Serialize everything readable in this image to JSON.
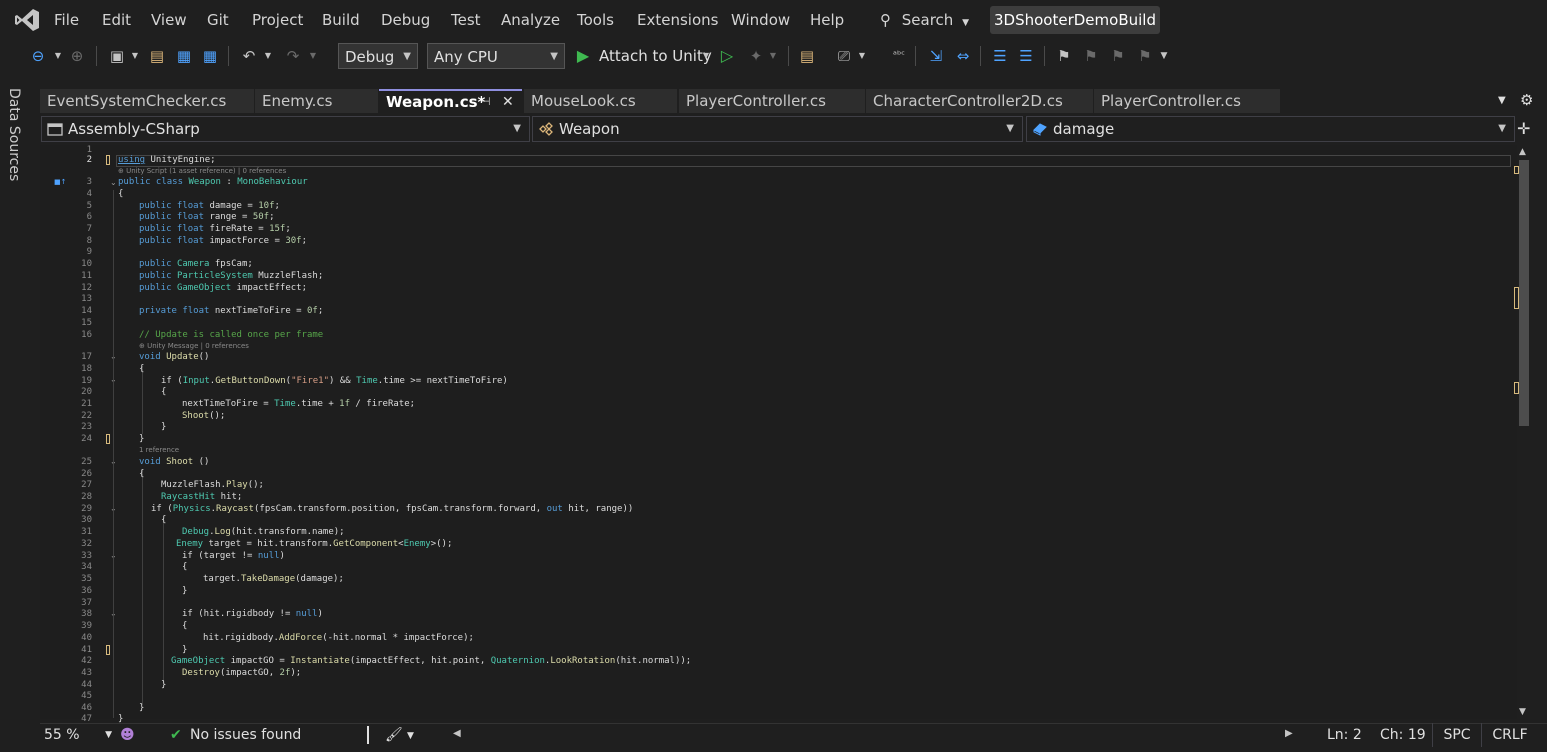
{
  "window": {
    "solution_name": "3DShooterDemoBuild"
  },
  "menu": [
    "File",
    "Edit",
    "View",
    "Git",
    "Project",
    "Build",
    "Debug",
    "Test",
    "Analyze",
    "Tools",
    "Extensions",
    "Window",
    "Help"
  ],
  "search": {
    "label": "Search"
  },
  "toolbar": {
    "configuration": "Debug",
    "platform": "Any CPU",
    "attach_label": "Attach to Unity"
  },
  "side_panel": {
    "label": "Data Sources"
  },
  "tabs": [
    {
      "label": "EventSystemChecker.cs",
      "active": false
    },
    {
      "label": "Enemy.cs",
      "active": false
    },
    {
      "label": "Weapon.cs*",
      "active": true
    },
    {
      "label": "MouseLook.cs",
      "active": false
    },
    {
      "label": "PlayerController.cs",
      "active": false
    },
    {
      "label": "CharacterController2D.cs",
      "active": false
    },
    {
      "label": "PlayerController.cs",
      "active": false
    }
  ],
  "navbar": {
    "project": "Assembly-CSharp",
    "type": "Weapon",
    "member": "damage"
  },
  "editor": {
    "current_line": 2,
    "line_numbers": [
      "1",
      "2",
      "3",
      "4",
      "5",
      "6",
      "7",
      "8",
      "9",
      "10",
      "11",
      "12",
      "13",
      "14",
      "15",
      "16",
      "17",
      "18",
      "19",
      "20",
      "21",
      "22",
      "23",
      "24",
      "25",
      "26",
      "27",
      "28",
      "29",
      "30",
      "31",
      "32",
      "33",
      "34",
      "35",
      "36",
      "37",
      "38",
      "39",
      "40",
      "41",
      "42",
      "43",
      "44",
      "45",
      "46",
      "47"
    ],
    "lens": {
      "class": "Unity Script (1 asset reference) | 0 references",
      "update": "Unity Message | 0 references",
      "shoot": "1 reference"
    },
    "code": {
      "l2": [
        "using",
        "UnityEngine;"
      ],
      "l3": [
        "public class",
        "Weapon",
        ":",
        "MonoBehaviour"
      ],
      "l4": "{",
      "l5": [
        "public float",
        "damage =",
        "10f",
        ";"
      ],
      "l6": [
        "public float",
        "range =",
        "50f",
        ";"
      ],
      "l7": [
        "public float",
        "fireRate =",
        "15f",
        ";"
      ],
      "l8": [
        "public float",
        "impactForce =",
        "30f",
        ";"
      ],
      "l10": [
        "public",
        "Camera",
        "fpsCam;"
      ],
      "l11": [
        "public",
        "ParticleSystem",
        "MuzzleFlash;"
      ],
      "l12": [
        "public",
        "GameObject",
        "impactEffect;"
      ],
      "l14": [
        "private float",
        "nextTimeToFire =",
        "0f",
        ";"
      ],
      "l16": "// Update is called once per frame",
      "l17": [
        "void",
        "Update",
        "()"
      ],
      "l18": "{",
      "l19": [
        "if (",
        "Input",
        ".",
        "GetButtonDown",
        "(",
        "\"Fire1\"",
        ") && ",
        "Time",
        ".time >= nextTimeToFire)"
      ],
      "l20": "{",
      "l21": [
        "nextTimeToFire = ",
        "Time",
        ".time + ",
        "1f",
        " / fireRate;"
      ],
      "l22": [
        "Shoot",
        "();"
      ],
      "l23": "}",
      "l24": "}",
      "l25": [
        "void",
        "Shoot",
        "()"
      ],
      "l26": "{",
      "l27": [
        "MuzzleFlash.",
        "Play",
        "();"
      ],
      "l28": [
        "RaycastHit",
        " hit;"
      ],
      "l29": [
        "if (",
        "Physics",
        ".",
        "Raycast",
        "(fpsCam.transform.position, fpsCam.transform.forward, ",
        "out",
        " hit, range))"
      ],
      "l30": "{",
      "l31": [
        "Debug",
        ".",
        "Log",
        "(hit.transform.name);"
      ],
      "l32": [
        "Enemy",
        " target = hit.transform.",
        "GetComponent",
        "<",
        "Enemy",
        ">();"
      ],
      "l33": [
        "if (target != ",
        "null",
        ")"
      ],
      "l34": "{",
      "l35": [
        "target.",
        "TakeDamage",
        "(damage);"
      ],
      "l36": "}",
      "l38": [
        "if (hit.rigidbody != ",
        "null",
        ")"
      ],
      "l39": "{",
      "l40": [
        "hit.rigidbody.",
        "AddForce",
        "(-hit.normal * impactForce);"
      ],
      "l41": "}",
      "l42": [
        "GameObject",
        " impactGO = ",
        "Instantiate",
        "(impactEffect, hit.point, ",
        "Quaternion",
        ".",
        "LookRotation",
        "(hit.normal));"
      ],
      "l43": [
        "Destroy",
        "(impactGO, ",
        "2f",
        ");"
      ],
      "l44": "}",
      "l46": "}",
      "l47": "}"
    }
  },
  "statusbar": {
    "zoom": "55 %",
    "issues": "No issues found",
    "line": "Ln: 2",
    "column": "Ch: 19",
    "whitespace": "SPC",
    "line_ending": "CRLF"
  },
  "colors": {
    "accent": "#8f8fdf",
    "run_green": "#3fb950",
    "change_marker": "#d7ba7d"
  }
}
